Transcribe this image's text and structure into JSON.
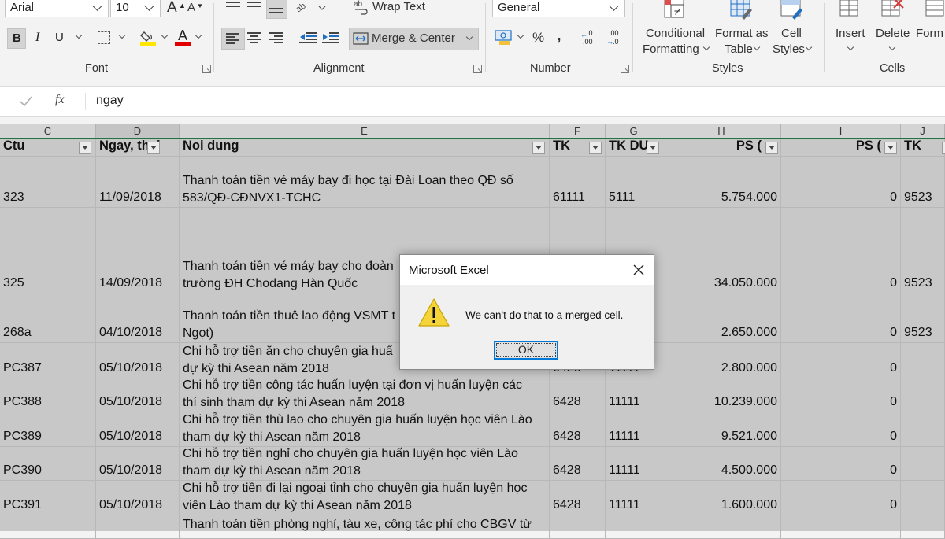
{
  "ribbon": {
    "font": {
      "name": "Arial",
      "size": "10",
      "grow_label": "A",
      "shrink_label": "A",
      "bold": "B",
      "italic": "I",
      "underline": "U",
      "font_color_label": "A",
      "group_label": "Font"
    },
    "alignment": {
      "wrap_text": "Wrap Text",
      "merge_center": "Merge & Center",
      "group_label": "Alignment"
    },
    "number": {
      "format": "General",
      "percent": "%",
      "comma": ",",
      "group_label": "Number"
    },
    "styles": {
      "conditional_formatting": [
        "Conditional",
        "Formatting"
      ],
      "format_as_table": [
        "Format as",
        "Table"
      ],
      "cell_styles": [
        "Cell",
        "Styles"
      ],
      "group_label": "Styles"
    },
    "cells": {
      "insert": "Insert",
      "delete": "Delete",
      "format": "Form",
      "group_label": "Cells"
    }
  },
  "formula_bar": {
    "fx_label": "fx",
    "content": "ngay"
  },
  "columns": [
    "C",
    "D",
    "E",
    "F",
    "G",
    "H",
    "I",
    "J"
  ],
  "header_row": [
    "Ctu",
    "Ngay, thai",
    "Noi dung",
    "TK",
    "TK DU",
    "PS (",
    "PS (",
    "TK"
  ],
  "rows": [
    {
      "ctu": "323",
      "ngay": "11/09/2018",
      "nd1": "Thanh toán tiền vé máy bay đi học tại Đài Loan theo QĐ số",
      "nd2": "583/QĐ-CĐNVX1-TCHC",
      "tk": "61111",
      "tkdu": "5111",
      "ps_no": "5.754.000",
      "ps_co": "0",
      "tk2": "9523"
    },
    {
      "ctu": "325",
      "ngay": "14/09/2018",
      "nd1": "Thanh toán tiền vé máy bay cho đoàn",
      "nd2": "trường ĐH Chodang Hàn Quốc",
      "tk": "",
      "tkdu": "",
      "ps_no": "34.050.000",
      "ps_co": "0",
      "tk2": "9523"
    },
    {
      "ctu": "268a",
      "ngay": "04/10/2018",
      "nd1": "Thanh toán tiền thuê lao động VSMT t",
      "nd2": "Ngọt)",
      "tk": "",
      "tkdu": "",
      "ps_no": "2.650.000",
      "ps_co": "0",
      "tk2": "9523"
    },
    {
      "ctu": "PC387",
      "ngay": "05/10/2018",
      "nd1": "Chi hỗ trợ tiền ăn cho chuyên gia huấ",
      "nd2": "dự kỳ thi Asean năm 2018",
      "tk": "6428",
      "tkdu": "11111",
      "ps_no": "2.800.000",
      "ps_co": "0",
      "tk2": ""
    },
    {
      "ctu": "PC388",
      "ngay": "05/10/2018",
      "nd1": "Chi hỗ trợ tiền công tác huấn luyện tại đơn vị huấn luyện các",
      "nd2": "thí sinh tham dự kỳ thi Asean năm 2018",
      "tk": "6428",
      "tkdu": "11111",
      "ps_no": "10.239.000",
      "ps_co": "0",
      "tk2": ""
    },
    {
      "ctu": "PC389",
      "ngay": "05/10/2018",
      "nd1": "Chi hỗ trợ tiền thù lao cho chuyên gia huấn luyện học viên Lào",
      "nd2": "tham dự kỳ thi Asean năm 2018",
      "tk": "6428",
      "tkdu": "11111",
      "ps_no": "9.521.000",
      "ps_co": "0",
      "tk2": ""
    },
    {
      "ctu": "PC390",
      "ngay": "05/10/2018",
      "nd1": "Chi hỗ trợ tiền nghỉ cho chuyên gia huấn luyện học viên Lào",
      "nd2": "tham dự kỳ thi Asean năm 2018",
      "tk": "6428",
      "tkdu": "11111",
      "ps_no": "4.500.000",
      "ps_co": "0",
      "tk2": ""
    },
    {
      "ctu": "PC391",
      "ngay": "05/10/2018",
      "nd1": "Chi hỗ trợ tiền đi lại ngoại tỉnh cho chuyên gia huấn luyện học",
      "nd2": "viên Lào tham dự kỳ thi Asean năm 2018",
      "tk": "6428",
      "tkdu": "11111",
      "ps_no": "1.600.000",
      "ps_co": "0",
      "tk2": ""
    },
    {
      "ctu": "",
      "ngay": "",
      "nd1": "Thanh toán tiền phòng nghỉ, tàu xe, công tác phí cho CBGV từ",
      "nd2": "",
      "tk": "",
      "tkdu": "",
      "ps_no": "",
      "ps_co": "",
      "tk2": ""
    }
  ],
  "dialog": {
    "title": "Microsoft Excel",
    "message": "We can't do that to a merged cell.",
    "ok_label": "OK"
  },
  "colors": {
    "accent_green": "#217346",
    "dialog_focus": "#0078d7",
    "warning_yellow": "#f5d43a"
  }
}
